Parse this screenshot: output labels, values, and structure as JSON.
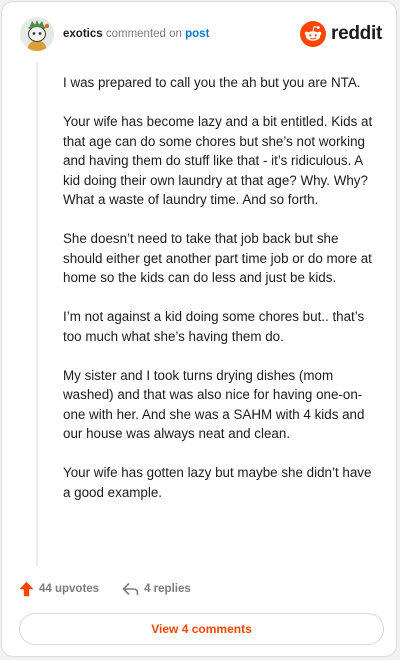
{
  "comment": {
    "username": "exotics",
    "action_text": "commented on",
    "post_link": "post",
    "brand_name": "reddit",
    "paragraphs": [
      "I was prepared to call you the ah but you are NTA.",
      "Your wife has become lazy and a bit entitled. Kids at that age can do some chores but she’s not working and having them do stuff like that - it’s ridiculous. A kid doing their own laundry at that age? Why. Why? What a waste of laundry time. And so forth.",
      "She doesn’t need to take that job back but she should either get another part time job or do more at home so the kids can do less and just be kids.",
      "I’m not against a kid doing some chores but.. that’s too much what she’s having them do.",
      "My sister and I took turns drying dishes (mom washed) and that was also nice for having one-on-one with her. And she was a SAHM with 4 kids and our house was always neat and clean.",
      "Your wife has gotten lazy but maybe she didn’t have a good example."
    ],
    "upvotes_label": "44 upvotes",
    "replies_label": "4 replies",
    "view_comments_label": "View 4 comments"
  },
  "colors": {
    "accent_orange": "#ff4500",
    "link_blue": "#0079d3",
    "muted_text": "#7c7c7c",
    "body_text": "#1c1c1c"
  },
  "icons": {
    "avatar": "snoo-avatar-icon",
    "brand": "reddit-snoo-logo-icon",
    "upvote": "upvote-arrow-icon",
    "reply": "reply-arrow-icon"
  }
}
